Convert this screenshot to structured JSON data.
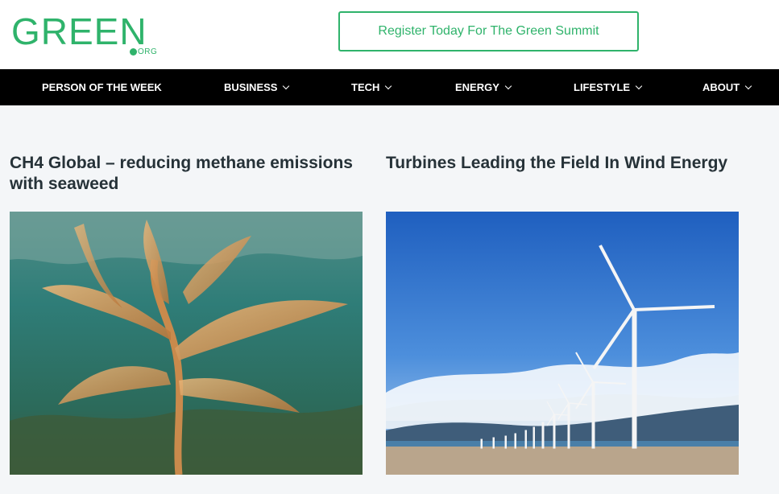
{
  "logo": {
    "word": "GREEN",
    "suffix": "ORG"
  },
  "header": {
    "cta_label": "Register Today For The Green Summit"
  },
  "nav": {
    "items": [
      {
        "label": "PERSON OF THE WEEK",
        "has_dropdown": false
      },
      {
        "label": "BUSINESS",
        "has_dropdown": true
      },
      {
        "label": "TECH",
        "has_dropdown": true
      },
      {
        "label": "ENERGY",
        "has_dropdown": true
      },
      {
        "label": "LIFESTYLE",
        "has_dropdown": true
      },
      {
        "label": "ABOUT",
        "has_dropdown": true
      }
    ]
  },
  "articles": [
    {
      "title": "CH4 Global – reducing methane emissions with seaweed",
      "image": "seaweed-underwater-photo"
    },
    {
      "title": "Turbines Leading the Field In Wind Energy",
      "image": "wind-turbines-beach-photo"
    }
  ],
  "colors": {
    "brand": "#2fb36b",
    "nav_bg": "#000000",
    "page_bg": "#f4f6f8",
    "title": "#263238"
  }
}
